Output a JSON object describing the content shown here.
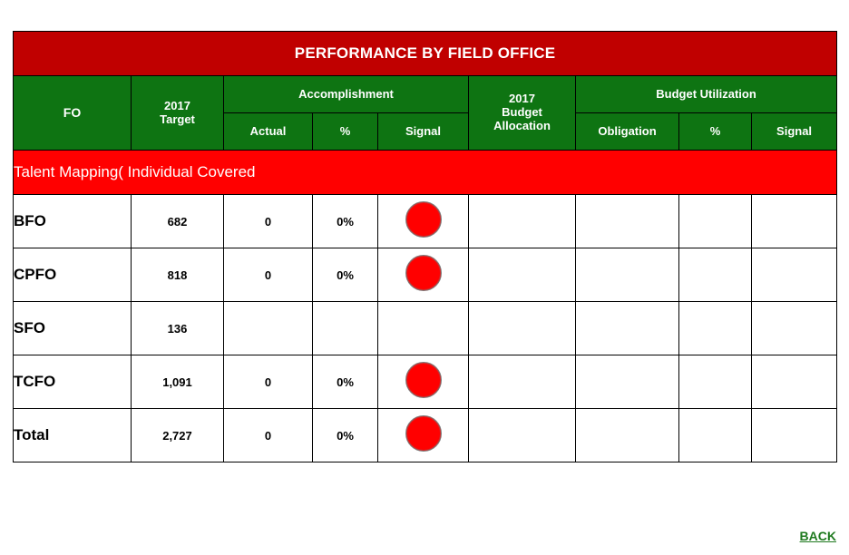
{
  "title": "PERFORMANCE BY FIELD OFFICE",
  "header": {
    "fo": "FO",
    "target": "2017\nTarget",
    "target_line1": "2017",
    "target_line2": "Target",
    "accomplishment": "Accomplishment",
    "actual": "Actual",
    "percent": "%",
    "signal": "Signal",
    "budget_allocation_line1": "2017",
    "budget_allocation_line2": "Budget",
    "budget_allocation_line3": "Allocation",
    "budget_utilization": "Budget Utilization",
    "obligation": "Obligation",
    "util_percent": "%",
    "util_signal": "Signal"
  },
  "section": {
    "label": "Talent Mapping( Individual Covered"
  },
  "rows": [
    {
      "fo": "BFO",
      "target": "682",
      "actual": "0",
      "percent": "0%",
      "signal": "red",
      "budget_allocation": "",
      "obligation": "",
      "util_percent": "",
      "util_signal": ""
    },
    {
      "fo": "CPFO",
      "target": "818",
      "actual": "0",
      "percent": "0%",
      "signal": "red",
      "budget_allocation": "",
      "obligation": "",
      "util_percent": "",
      "util_signal": ""
    },
    {
      "fo": "SFO",
      "target": "136",
      "actual": "",
      "percent": "",
      "signal": "",
      "budget_allocation": "",
      "obligation": "",
      "util_percent": "",
      "util_signal": ""
    },
    {
      "fo": "TCFO",
      "target": "1,091",
      "actual": "0",
      "percent": "0%",
      "signal": "red",
      "budget_allocation": "",
      "obligation": "",
      "util_percent": "",
      "util_signal": ""
    },
    {
      "fo": "Total",
      "target": "2,727",
      "actual": "0",
      "percent": "0%",
      "signal": "red",
      "budget_allocation": "",
      "obligation": "",
      "util_percent": "",
      "util_signal": ""
    }
  ],
  "footer": {
    "back_label": "BACK"
  },
  "colors": {
    "title_bar": "#C00000",
    "header_green": "#0E7412",
    "section_red": "#FF0000",
    "signal_red": "#FF0000",
    "back_link": "#1F7A1F"
  }
}
